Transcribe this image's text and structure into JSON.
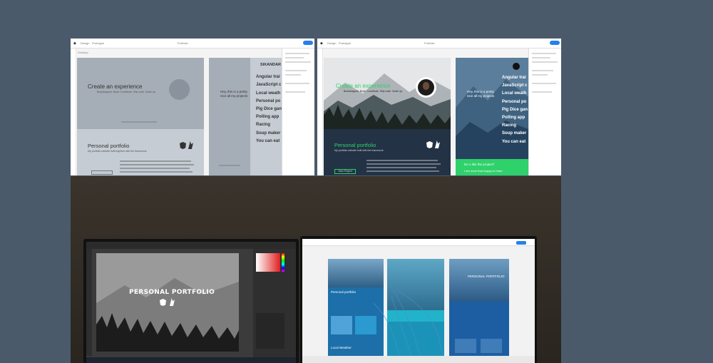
{
  "colors": {
    "background": "#4a5a6b",
    "accent_green": "#2fd16b",
    "accent_blue": "#2680eb"
  },
  "wireframe": {
    "artboard_label": "Desktop",
    "hero_title": "Create an experience",
    "hero_subtitle": "Bootstrapped. Build. Contribute. Ship code. Scale up.",
    "section_title": "Personal portfolio",
    "section_subtitle": "My portfolio website built together with the framework",
    "menu_header": "SIKANDAR F",
    "menu_items": [
      "Angular trai",
      "JavaScript c",
      "Local weath",
      "Personal po",
      "Pig Dice gan",
      "Polling app",
      "Racing",
      "Soup maker",
      "You can eat"
    ],
    "tagline": "Hey, this is a pretty\nnice all my projects",
    "tech_icons": [
      "angular-icon",
      "firebase-icon"
    ]
  },
  "mockup": {
    "hero_title": "Create an experience",
    "hero_subtitle": "Bootstrapped. Build. Contribute. Ship code. Scale up.",
    "section_title": "Personal portfolio",
    "section_subtitle": "My portfolio website built with the framework",
    "button_label": "View Project",
    "menu_items": [
      "Angular trai",
      "JavaScript c",
      "Local weath",
      "Personal po",
      "Pig Dice gan",
      "Polling app",
      "Racing",
      "Soup maker",
      "You can eat"
    ],
    "tagline": "Hey, this is a pretty\nnice all my projects",
    "cta_title": "Do u like the project?",
    "cta_subtitle": "I am more than happy to hear!"
  },
  "photo": {
    "photoshop_title": "PERSONAL PORTFOLIO",
    "right_card_title": "PERSONAL PORTFOLIO",
    "mini_section_title": "Personal portfolio",
    "mini_section_title_2": "Local Weather"
  }
}
